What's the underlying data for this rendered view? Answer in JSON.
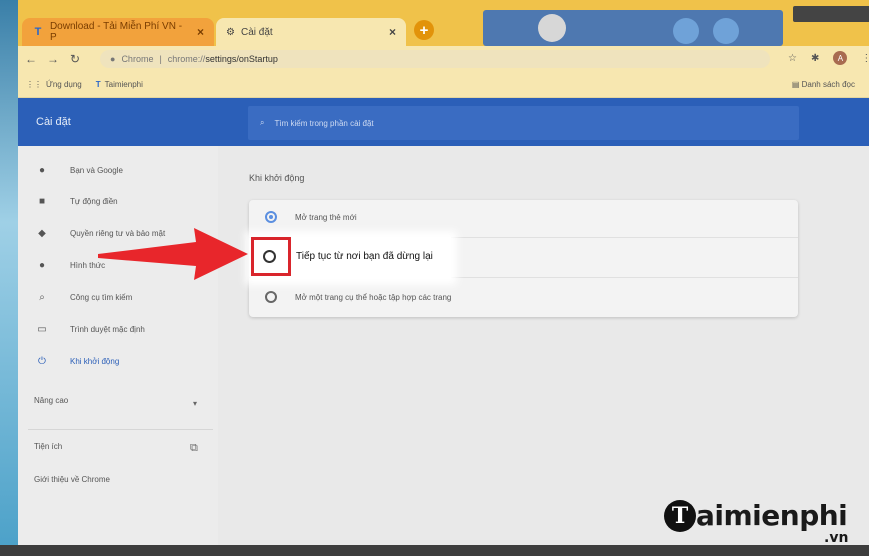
{
  "browser": {
    "tabs": [
      {
        "title": "Download - Tải Miễn Phí VN - P",
        "active": false
      },
      {
        "title": "Cài đặt",
        "active": true
      }
    ],
    "new_tab_label": "+",
    "omnibox": {
      "scheme": "Chrome",
      "separator": "|",
      "url_prefix": "chrome://",
      "url_path": "settings/onStartup"
    },
    "bookmarks": [
      {
        "label": "Ứng dụng"
      },
      {
        "label": "Taimienphi"
      }
    ],
    "bookmarks_other": "Danh sách đọc",
    "profile_initial": "A"
  },
  "settings": {
    "title": "Cài đặt",
    "search_placeholder": "Tìm kiếm trong phần cài đặt",
    "sidebar": {
      "items": [
        {
          "label": "Bạn và Google",
          "icon": "person-icon",
          "selected": false
        },
        {
          "label": "Tự động điền",
          "icon": "clipboard-icon",
          "selected": false
        },
        {
          "label": "Quyền riêng tư và bảo mật",
          "icon": "shield-icon",
          "selected": false
        },
        {
          "label": "Hình thức",
          "icon": "palette-icon",
          "selected": false
        },
        {
          "label": "Công cụ tìm kiếm",
          "icon": "search-icon",
          "selected": false
        },
        {
          "label": "Trình duyệt mặc định",
          "icon": "browser-icon",
          "selected": false
        },
        {
          "label": "Khi khởi động",
          "icon": "power-icon",
          "selected": true
        }
      ],
      "advanced": "Nâng cao",
      "extensions": "Tiện ích",
      "about": "Giới thiệu về Chrome"
    },
    "section_title": "Khi khởi động",
    "options": [
      {
        "label": "Mở trang thẻ mới",
        "checked": true
      },
      {
        "label": "Tiếp tục từ nơi bạn đã dừng lại",
        "checked": false
      },
      {
        "label": "Mở một trang cụ thể hoặc tập hợp các trang",
        "checked": false
      }
    ]
  },
  "watermark": {
    "brand_letter": "T",
    "brand": "aimienphi",
    "tld": ".vn"
  },
  "colors": {
    "accent": "#2b5fb8",
    "tab_bar": "#f0c24a",
    "highlight": "#d9252c",
    "arrow": "#e8262b"
  }
}
